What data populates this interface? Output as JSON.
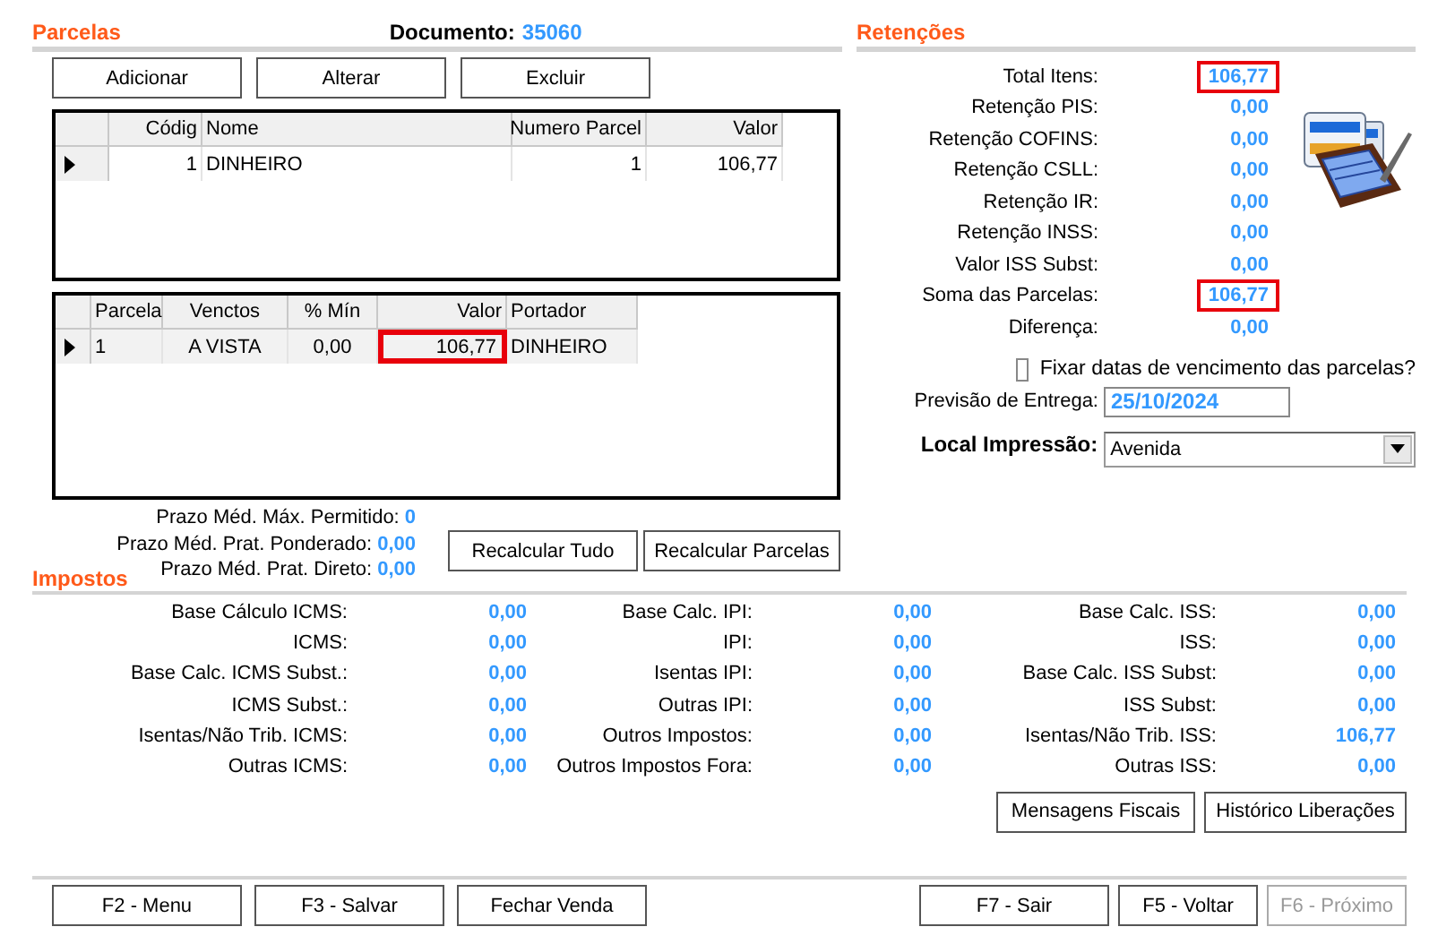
{
  "parcelas": {
    "title": "Parcelas",
    "document_label": "Documento:",
    "document_number": "35060",
    "buttons": [
      "Adicionar",
      "Alterar",
      "Excluir"
    ],
    "forms_grid": {
      "columns": [
        "Códig",
        "Nome",
        "Numero Parcel",
        "Valor"
      ],
      "rows": [
        {
          "selected": true,
          "cells": [
            {
              "text": "1",
              "highlighted": false
            },
            {
              "text": "DINHEIRO",
              "highlighted": false
            },
            {
              "text": "1",
              "highlighted": false
            },
            {
              "text": "106,77",
              "highlighted": false
            }
          ]
        }
      ]
    },
    "installments_grid": {
      "columns": [
        "Parcela",
        "Venctos",
        "% Mín",
        "Valor",
        "Portador"
      ],
      "rows": [
        {
          "selected": true,
          "cells": [
            {
              "text": "1",
              "highlighted": false
            },
            {
              "text": "A VISTA",
              "highlighted": false
            },
            {
              "text": "0,00",
              "highlighted": false
            },
            {
              "text": "106,77",
              "highlighted": true
            },
            {
              "text": "DINHEIRO",
              "highlighted": false
            }
          ]
        }
      ]
    },
    "terms": [
      {
        "label": "Prazo Méd. Máx. Permitido:",
        "value": "0"
      },
      {
        "label": "Prazo Méd. Prat. Ponderado:",
        "value": "0,00"
      },
      {
        "label": "Prazo Méd. Prat. Direto:",
        "value": "0,00"
      }
    ],
    "recalc_buttons": [
      "Recalcular Tudo",
      "Recalcular Parcelas"
    ]
  },
  "retencoes": {
    "title": "Retenções",
    "rows": [
      {
        "label": "Total Itens:",
        "value": "106,77",
        "highlighted": true
      },
      {
        "label": "Retenção PIS:",
        "value": "0,00",
        "highlighted": false
      },
      {
        "label": "Retenção COFINS:",
        "value": "0,00",
        "highlighted": false
      },
      {
        "label": "Retenção CSLL:",
        "value": "0,00",
        "highlighted": false
      },
      {
        "label": "Retenção IR:",
        "value": "0,00",
        "highlighted": false
      },
      {
        "label": "Retenção INSS:",
        "value": "0,00",
        "highlighted": false
      },
      {
        "label": "Valor ISS Subst:",
        "value": "0,00",
        "highlighted": false
      },
      {
        "label": "Soma das Parcelas:",
        "value": "106,77",
        "highlighted": true
      },
      {
        "label": "Diferença:",
        "value": "0,00",
        "highlighted": false
      }
    ],
    "fix_dates": {
      "label": "Fixar datas de vencimento das parcelas?",
      "checked": false
    },
    "delivery": {
      "label": "Previsão de Entrega:",
      "value": "25/10/2024"
    },
    "print_location": {
      "label": "Local Impressão:",
      "value": "Avenida"
    }
  },
  "impostos": {
    "title": "Impostos",
    "columns": [
      [
        {
          "label": "Base Cálculo ICMS:",
          "value": "0,00"
        },
        {
          "label": "ICMS:",
          "value": "0,00"
        },
        {
          "label": "Base Calc. ICMS Subst.:",
          "value": "0,00"
        },
        {
          "label": "ICMS Subst.:",
          "value": "0,00"
        },
        {
          "label": "Isentas/Não Trib. ICMS:",
          "value": "0,00"
        },
        {
          "label": "Outras ICMS:",
          "value": "0,00"
        }
      ],
      [
        {
          "label": "Base Calc. IPI:",
          "value": "0,00"
        },
        {
          "label": "IPI:",
          "value": "0,00"
        },
        {
          "label": "Isentas IPI:",
          "value": "0,00"
        },
        {
          "label": "Outras IPI:",
          "value": "0,00"
        },
        {
          "label": "Outros Impostos:",
          "value": "0,00"
        },
        {
          "label": "Outros Impostos Fora:",
          "value": "0,00"
        }
      ],
      [
        {
          "label": "Base Calc. ISS:",
          "value": "0,00"
        },
        {
          "label": "ISS:",
          "value": "0,00"
        },
        {
          "label": "Base Calc. ISS Subst:",
          "value": "0,00"
        },
        {
          "label": "ISS Subst:",
          "value": "0,00"
        },
        {
          "label": "Isentas/Não Trib. ISS:",
          "value": "106,77"
        },
        {
          "label": "Outras ISS:",
          "value": "0,00"
        }
      ]
    ],
    "buttons": [
      "Mensagens Fiscais",
      "Histórico Liberações"
    ]
  },
  "footer": {
    "left": [
      {
        "label": "F2 - Menu",
        "disabled": false
      },
      {
        "label": "F3 - Salvar",
        "disabled": false
      },
      {
        "label": "Fechar Venda",
        "disabled": false
      }
    ],
    "right": [
      {
        "label": "F7 - Sair",
        "disabled": false
      },
      {
        "label": "F5 - Voltar",
        "disabled": false
      },
      {
        "label": "F6 - Próximo",
        "disabled": true
      }
    ]
  }
}
